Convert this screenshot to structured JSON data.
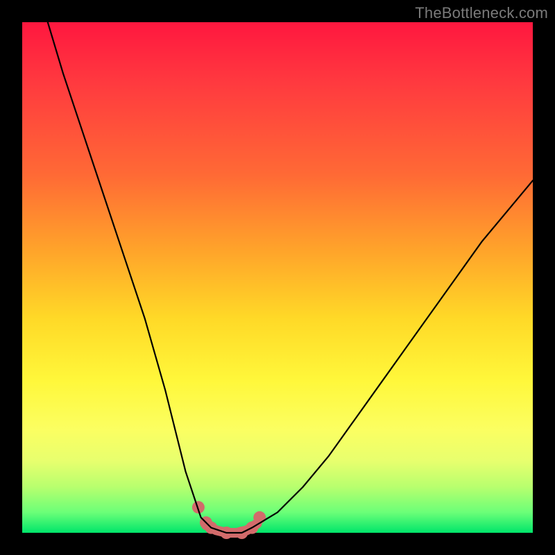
{
  "watermark": "TheBottleneck.com",
  "chart_data": {
    "type": "line",
    "title": "",
    "xlabel": "",
    "ylabel": "",
    "xlim": [
      0,
      100
    ],
    "ylim": [
      0,
      100
    ],
    "series": [
      {
        "name": "bottleneck-curve",
        "x": [
          5,
          8,
          12,
          16,
          20,
          24,
          28,
          30,
          32,
          34,
          35,
          37,
          40,
          43,
          45,
          50,
          55,
          60,
          65,
          70,
          75,
          80,
          85,
          90,
          95,
          100
        ],
        "values": [
          100,
          90,
          78,
          66,
          54,
          42,
          28,
          20,
          12,
          6,
          3,
          1,
          0,
          0,
          1,
          4,
          9,
          15,
          22,
          29,
          36,
          43,
          50,
          57,
          63,
          69
        ]
      }
    ],
    "markers": {
      "name": "trough-markers",
      "x": [
        34.5,
        36,
        37,
        40,
        43,
        45,
        46.5
      ],
      "values": [
        5,
        2,
        1,
        0,
        0,
        1,
        3
      ]
    },
    "trough_segment": {
      "name": "trough-bar",
      "x": [
        36,
        38,
        40,
        42,
        44,
        46
      ],
      "values": [
        1.5,
        0.5,
        0,
        0,
        0.5,
        1.8
      ]
    },
    "colors": {
      "curve": "#000000",
      "markers": "#d26b6b",
      "trough": "#d26b6b",
      "gradient_top": "#ff173f",
      "gradient_bottom": "#00e56a"
    }
  }
}
